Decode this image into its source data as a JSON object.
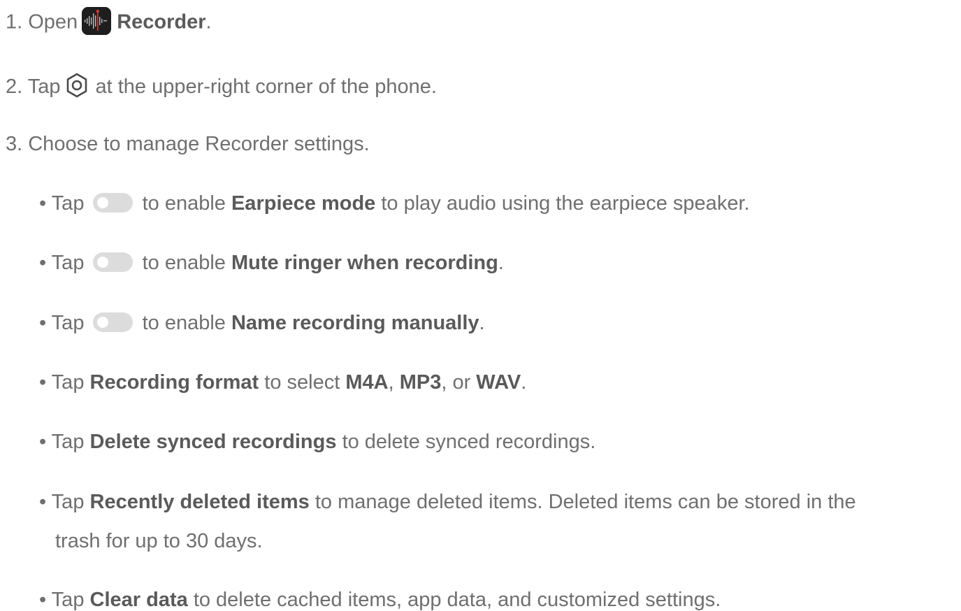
{
  "steps": {
    "s1": {
      "prefix": "1. Open",
      "bold": "Recorder",
      "suffix": "."
    },
    "s2": {
      "prefix": "2. Tap",
      "suffix": "at the upper-right corner of the phone."
    },
    "s3": {
      "text": "3. Choose to manage Recorder settings."
    }
  },
  "bullets": {
    "b1": {
      "prefix": "• Tap",
      "mid": "to enable",
      "bold": "Earpiece mode",
      "suffix": "to play audio using the earpiece speaker."
    },
    "b2": {
      "prefix": "• Tap",
      "mid": "to enable",
      "bold": "Mute ringer when recording",
      "suffix": "."
    },
    "b3": {
      "prefix": "• Tap",
      "mid": "to enable",
      "bold": "Name recording manually",
      "suffix": "."
    },
    "b4": {
      "prefix": "• Tap",
      "bold1": "Recording format",
      "mid": "to select",
      "bold2": "M4A",
      "sep1": ",",
      "bold3": "MP3",
      "sep2": ", or",
      "bold4": "WAV",
      "suffix": "."
    },
    "b5": {
      "prefix": "• Tap",
      "bold": "Delete synced recordings",
      "suffix": "to delete synced recordings."
    },
    "b6": {
      "prefix": "• Tap",
      "bold": "Recently deleted items",
      "suffix": "to manage deleted items. Deleted items can be stored in the",
      "continuation": "trash for up to 30 days."
    },
    "b7": {
      "prefix": "• Tap",
      "bold": "Clear data",
      "suffix": "to delete cached items, app data, and customized settings."
    }
  },
  "icons": {
    "recorder": "recorder-app-icon",
    "settings": "settings-gear-icon",
    "toggle": "toggle-switch-icon"
  },
  "colors": {
    "text": "#6f6f6f",
    "bold_text": "#5a5a5a",
    "toggle_off": "#dcdcdc",
    "app_icon_bg": "#1e1e1e",
    "app_icon_accent": "#e53935"
  }
}
